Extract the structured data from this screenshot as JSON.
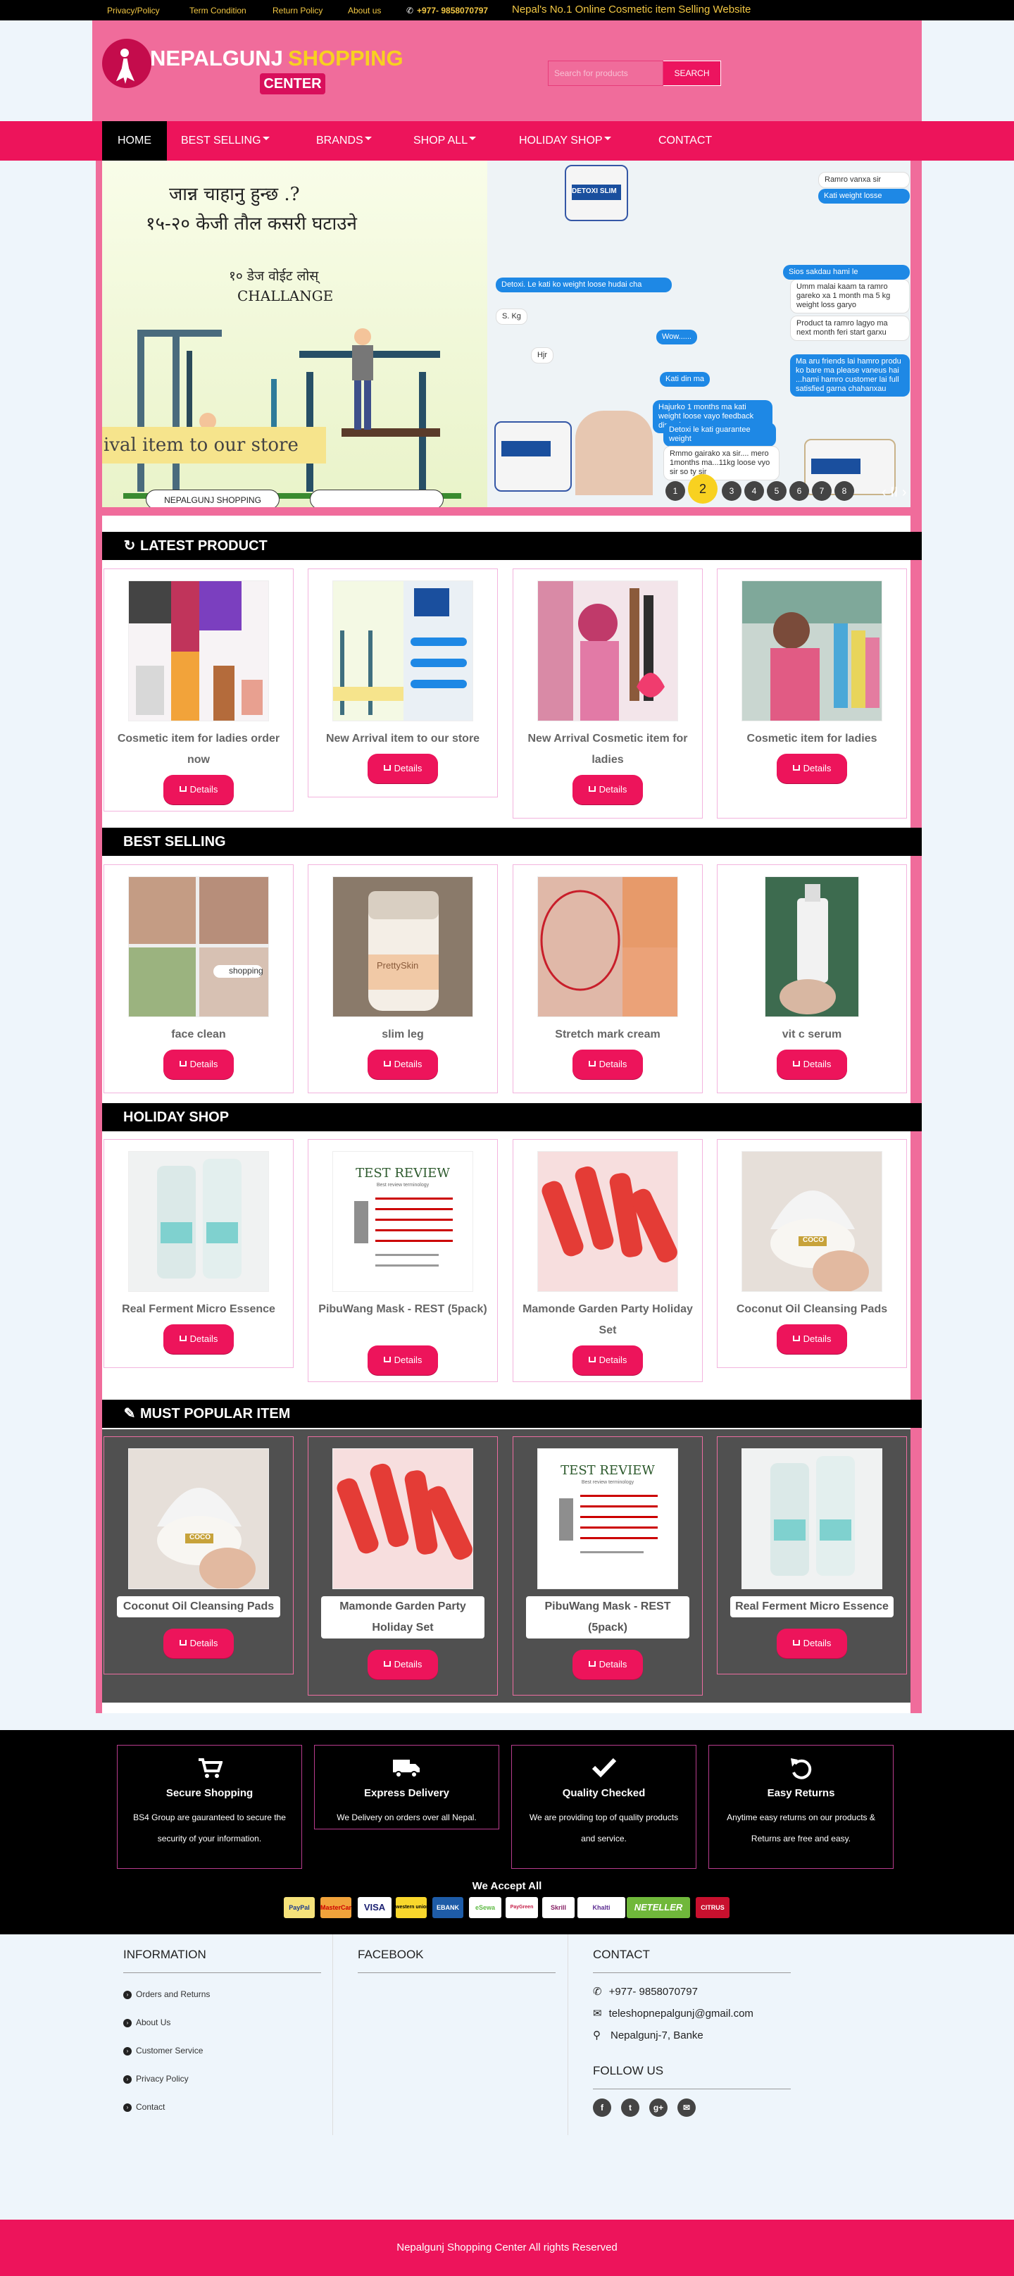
{
  "topbar": {
    "links": [
      "Privacy/Policy",
      "Term Condition",
      "Return Policy",
      "About us"
    ],
    "phone": "+977- 9858070797",
    "tagline": "Nepal's No.1 Online Cosmetic item Selling Website"
  },
  "header": {
    "logo_part1": "NEPALGUNJ",
    "logo_part2": "SHOPPING",
    "logo_part3": "CENTER",
    "search_placeholder": "Search for products",
    "search_button": "SEARCH"
  },
  "nav": {
    "items": [
      "HOME",
      "BEST SELLING",
      "BRANDS",
      "SHOP ALL",
      "HOLIDAY SHOP",
      "CONTACT"
    ]
  },
  "slider": {
    "nepali_line1": "जान्न चाहानु हुन्छ .?",
    "nepali_line2": "१५-२० केजी तौल कसरी घटाउने",
    "nepali_line3": "१० डेज वोईट लोस्",
    "challenge": "CHALLANGE",
    "banner": "ival item to our store",
    "button1": "NEPALGUNJ SHOPPING",
    "chat": [
      "Detoxi. Le kati ko weight loose hudai cha",
      "S. Kg",
      "Hjr",
      "Wow......",
      "Kati din ma",
      "Hajurko 1 months ma kati weight loose vayo feedback dinus jee",
      "Detoxi le kati guarantee weight",
      "Rmmo gairako xa sir.... mero 1months ma...11kg loose vyo sir so ty sir",
      "Umm malai kaam ta ramro gareko xa 1 month ma 5 kg weight loss garyo",
      "Product ta ramro lagyo ma next month feri start garxu",
      "Ma aru friends lai hamro produ ko bare ma please vaneus hai ...hami hamro customer lai full satisfied garna chahanxau",
      "Kati weight losse",
      "Ramro vanxa sir",
      "Sios sakdau hami le"
    ],
    "product_label": "DETOXI SLIM",
    "dots": [
      "1",
      "2",
      "3",
      "4",
      "5",
      "6",
      "7",
      "8"
    ],
    "active_dot": "2",
    "controls": "‹ II ›"
  },
  "sections": {
    "latest": {
      "title": "LATEST PRODUCT",
      "products": [
        {
          "name": "Cosmetic item for ladies order now",
          "button": "Details"
        },
        {
          "name": "New Arrival item to our store",
          "button": "Details"
        },
        {
          "name": "New Arrival Cosmetic item for ladies",
          "button": "Details"
        },
        {
          "name": "Cosmetic item for ladies",
          "button": "Details"
        }
      ]
    },
    "best": {
      "title": "BEST SELLING",
      "products": [
        {
          "name": "face clean",
          "button": "Details"
        },
        {
          "name": "slim leg",
          "button": "Details"
        },
        {
          "name": "Stretch mark cream",
          "button": "Details"
        },
        {
          "name": "vit c serum",
          "button": "Details"
        }
      ]
    },
    "holiday": {
      "title": "HOLIDAY SHOP",
      "products": [
        {
          "name": "Real Ferment Micro Essence",
          "button": "Details"
        },
        {
          "name": "PibuWang Mask - REST (5pack)",
          "button": "Details"
        },
        {
          "name": "Mamonde Garden Party Holiday Set",
          "button": "Details"
        },
        {
          "name": "Coconut Oil Cleansing Pads",
          "button": "Details"
        }
      ]
    },
    "popular": {
      "title": "MUST POPULAR ITEM",
      "products": [
        {
          "name": "Coconut Oil Cleansing Pads",
          "button": "Details"
        },
        {
          "name": "Mamonde Garden Party Holiday Set",
          "button": "Details"
        },
        {
          "name": "PibuWang Mask - REST (5pack)",
          "button": "Details"
        },
        {
          "name": "Real Ferment Micro Essence",
          "button": "Details"
        }
      ]
    }
  },
  "image_texts": {
    "test_review": "TEST REVIEW",
    "test_review_sub": "Best review terminology",
    "shopping": "shopping",
    "prettyskin": "PrettySkin",
    "coco": "COCO"
  },
  "features": [
    {
      "icon": "cart-icon",
      "title": "Secure Shopping",
      "desc": "BS4 Group are gauranteed to secure the security of your information."
    },
    {
      "icon": "truck-icon",
      "title": "Express Delivery",
      "desc": "We Delivery on orders over all Nepal."
    },
    {
      "icon": "check-icon",
      "title": "Quality Checked",
      "desc": "We are providing top of quality products and service."
    },
    {
      "icon": "undo-icon",
      "title": "Easy Returns",
      "desc": "Anytime easy returns on our products & Returns are free and easy."
    }
  ],
  "payments": {
    "title": "We Accept All",
    "methods": [
      "PayPal",
      "MasterCard",
      "VISA",
      "western union",
      "EBANK",
      "eSewa",
      "PayGreen",
      "Skrill",
      "Khalti",
      "NETELLER",
      "CITRUS"
    ]
  },
  "footer": {
    "information": {
      "title": "INFORMATION",
      "links": [
        "Orders and Returns",
        "About Us",
        "Customer Service",
        "Privacy Policy",
        "Contact"
      ]
    },
    "facebook": {
      "title": "FACEBOOK"
    },
    "contact": {
      "title": "CONTACT",
      "phone": "+977- 9858070797",
      "email": "teleshopnepalgunj@gmail.com",
      "address": "Nepalgunj-7, Banke"
    },
    "follow": {
      "title": "FOLLOW US",
      "icons": [
        "f",
        "t",
        "g+",
        "✉"
      ]
    },
    "copyright": "Nepalgunj Shopping Center All rights Reserved"
  },
  "colors": {
    "brand_pink": "#ed145b",
    "header_pink": "#f06c9b",
    "accent_yellow": "#f8d120"
  }
}
